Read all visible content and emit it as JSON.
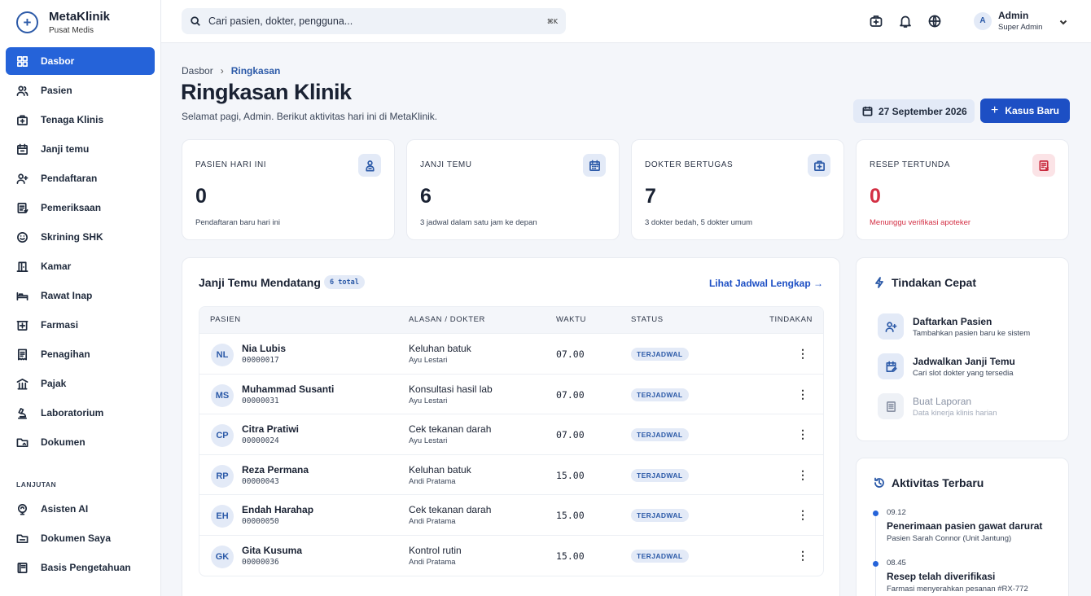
{
  "brand": {
    "name": "MetaKlinik",
    "subtitle": "Pusat Medis"
  },
  "sidebar": {
    "items": [
      {
        "label": "Dasbor",
        "icon": "grid-icon",
        "active": true
      },
      {
        "label": "Pasien",
        "icon": "users-icon"
      },
      {
        "label": "Tenaga Klinis",
        "icon": "medical-bag-icon"
      },
      {
        "label": "Janji temu",
        "icon": "calendar-icon"
      },
      {
        "label": "Pendaftaran",
        "icon": "user-plus-icon"
      },
      {
        "label": "Pemeriksaan",
        "icon": "clipboard-icon"
      },
      {
        "label": "Skrining SHK",
        "icon": "smile-icon"
      },
      {
        "label": "Kamar",
        "icon": "door-icon"
      },
      {
        "label": "Rawat Inap",
        "icon": "bed-icon"
      },
      {
        "label": "Farmasi",
        "icon": "pharmacy-icon"
      },
      {
        "label": "Penagihan",
        "icon": "receipt-icon"
      },
      {
        "label": "Pajak",
        "icon": "building-icon"
      },
      {
        "label": "Laboratorium",
        "icon": "microscope-icon"
      },
      {
        "label": "Dokumen",
        "icon": "folder-icon"
      }
    ],
    "section_label": "LANJUTAN",
    "advanced": [
      {
        "label": "Asisten AI",
        "icon": "ai-icon"
      },
      {
        "label": "Dokumen Saya",
        "icon": "folder-icon"
      },
      {
        "label": "Basis Pengetahuan",
        "icon": "book-icon"
      }
    ]
  },
  "topbar": {
    "search_placeholder": "Cari pasien, dokter, pengguna...",
    "search_shortcut": "⌘K",
    "user": {
      "initial": "A",
      "name": "Admin",
      "role": "Super Admin"
    }
  },
  "header": {
    "breadcrumb_root": "Dasbor",
    "breadcrumb_sep": "›",
    "breadcrumb_current": "Ringkasan",
    "title": "Ringkasan Klinik",
    "subtitle": "Selamat pagi, Admin. Berikut aktivitas hari ini di MetaKlinik.",
    "date": "27 September 2026",
    "new_case_label": "Kasus Baru"
  },
  "stats": [
    {
      "label": "PASIEN HARI INI",
      "value": "0",
      "note": "Pendaftaran baru hari ini",
      "icon": "patient-icon"
    },
    {
      "label": "JANJI TEMU",
      "value": "6",
      "note": "3 jadwal dalam satu jam ke depan",
      "icon": "calendar-icon"
    },
    {
      "label": "DOKTER BERTUGAS",
      "value": "7",
      "note": "3 dokter bedah, 5 dokter umum",
      "icon": "medical-bag-icon"
    },
    {
      "label": "RESEP TERTUNDA",
      "value": "0",
      "note": "Menunggu verifikasi apoteker",
      "icon": "prescription-icon"
    }
  ],
  "appointments": {
    "title": "Janji Temu Mendatang",
    "total_badge": "6 total",
    "view_all": "Lihat Jadwal Lengkap →",
    "columns": [
      "PASIEN",
      "ALASAN / DOKTER",
      "WAKTU",
      "STATUS",
      "TINDAKAN"
    ],
    "rows": [
      {
        "initials": "NL",
        "name": "Nia Lubis",
        "id": "00000017",
        "reason": "Keluhan batuk",
        "doctor": "Ayu Lestari",
        "time": "07.00",
        "status": "TERJADWAL"
      },
      {
        "initials": "MS",
        "name": "Muhammad Susanti",
        "id": "00000031",
        "reason": "Konsultasi hasil lab",
        "doctor": "Ayu Lestari",
        "time": "07.00",
        "status": "TERJADWAL"
      },
      {
        "initials": "CP",
        "name": "Citra Pratiwi",
        "id": "00000024",
        "reason": "Cek tekanan darah",
        "doctor": "Ayu Lestari",
        "time": "07.00",
        "status": "TERJADWAL"
      },
      {
        "initials": "RP",
        "name": "Reza Permana",
        "id": "00000043",
        "reason": "Keluhan batuk",
        "doctor": "Andi Pratama",
        "time": "15.00",
        "status": "TERJADWAL"
      },
      {
        "initials": "EH",
        "name": "Endah Harahap",
        "id": "00000050",
        "reason": "Cek tekanan darah",
        "doctor": "Andi Pratama",
        "time": "15.00",
        "status": "TERJADWAL"
      },
      {
        "initials": "GK",
        "name": "Gita Kusuma",
        "id": "00000036",
        "reason": "Kontrol rutin",
        "doctor": "Andi Pratama",
        "time": "15.00",
        "status": "TERJADWAL"
      }
    ]
  },
  "quick_actions": {
    "title": "Tindakan Cepat",
    "items": [
      {
        "title": "Daftarkan Pasien",
        "desc": "Tambahkan pasien baru ke sistem",
        "icon": "user-plus-icon"
      },
      {
        "title": "Jadwalkan Janji Temu",
        "desc": "Cari slot dokter yang tersedia",
        "icon": "calendar-edit-icon"
      },
      {
        "title": "Buat Laporan",
        "desc": "Data kinerja klinis harian",
        "icon": "report-icon"
      }
    ]
  },
  "activity": {
    "title": "Aktivitas Terbaru",
    "items": [
      {
        "time": "09.12",
        "title": "Penerimaan pasien gawat darurat",
        "desc": "Pasien Sarah Connor (Unit Jantung)"
      },
      {
        "time": "08.45",
        "title": "Resep telah diverifikasi",
        "desc": "Farmasi menyerahkan pesanan #RX-772"
      }
    ]
  },
  "colors": {
    "primary": "#2563d9",
    "primary_dark": "#1d4fc4",
    "danger": "#d32f44",
    "soft_blue": "#e3eaf7"
  }
}
